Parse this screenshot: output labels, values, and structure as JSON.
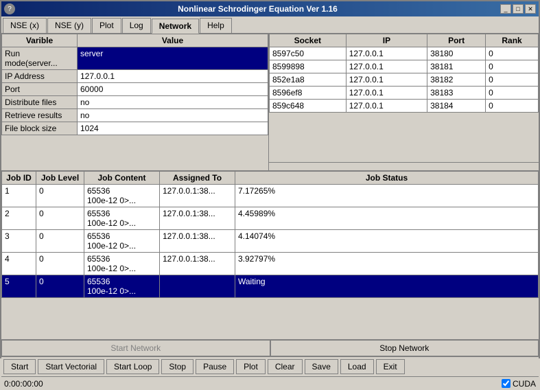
{
  "window": {
    "title": "Nonlinear Schrodinger Equation Ver 1.16",
    "icon": "?"
  },
  "titlebar": {
    "minimize_label": "_",
    "maximize_label": "□",
    "close_label": "✕"
  },
  "menu": {
    "tabs": [
      {
        "id": "nse-x",
        "label": "NSE (x)"
      },
      {
        "id": "nse-y",
        "label": "NSE (y)"
      },
      {
        "id": "plot",
        "label": "Plot"
      },
      {
        "id": "log",
        "label": "Log"
      },
      {
        "id": "network",
        "label": "Network",
        "active": true
      },
      {
        "id": "help",
        "label": "Help"
      }
    ]
  },
  "variables": {
    "header": {
      "varible": "Varible",
      "value": "Value"
    },
    "rows": [
      {
        "varible": "Run mode(server...",
        "value": "server",
        "selected": true
      },
      {
        "varible": "IP Address",
        "value": "127.0.0.1"
      },
      {
        "varible": "Port",
        "value": "60000"
      },
      {
        "varible": "Distribute files",
        "value": "no"
      },
      {
        "varible": "Retrieve results",
        "value": "no"
      },
      {
        "varible": "File block size",
        "value": "1024"
      }
    ]
  },
  "network": {
    "headers": [
      "Socket",
      "IP",
      "Port",
      "Rank"
    ],
    "rows": [
      {
        "socket": "8597c50",
        "ip": "127.0.0.1",
        "port": "38180",
        "rank": "0"
      },
      {
        "socket": "8599898",
        "ip": "127.0.0.1",
        "port": "38181",
        "rank": "0"
      },
      {
        "socket": "852e1a8",
        "ip": "127.0.0.1",
        "port": "38182",
        "rank": "0"
      },
      {
        "socket": "8596ef8",
        "ip": "127.0.0.1",
        "port": "38183",
        "rank": "0"
      },
      {
        "socket": "859c648",
        "ip": "127.0.0.1",
        "port": "38184",
        "rank": "0"
      }
    ]
  },
  "jobs": {
    "headers": [
      "Job ID",
      "Job Level",
      "Job Content",
      "Assigned To",
      "Job Status"
    ],
    "rows": [
      {
        "id": "1",
        "level": "0",
        "content": "65536\n100e-12 0>...",
        "assigned": "127.0.0.1:38...",
        "status": "7.17265%",
        "waiting": false
      },
      {
        "id": "2",
        "level": "0",
        "content": "65536\n100e-12 0>...",
        "assigned": "127.0.0.1:38...",
        "status": "4.45989%",
        "waiting": false
      },
      {
        "id": "3",
        "level": "0",
        "content": "65536\n100e-12 0>...",
        "assigned": "127.0.0.1:38...",
        "status": "4.14074%",
        "waiting": false
      },
      {
        "id": "4",
        "level": "0",
        "content": "65536\n100e-12 0>...",
        "assigned": "127.0.0.1:38...",
        "status": "3.92797%",
        "waiting": false
      },
      {
        "id": "5",
        "level": "0",
        "content": "65536\n100e-12 0>...",
        "assigned": "",
        "status": "Waiting",
        "waiting": true
      }
    ]
  },
  "actions": {
    "start_network": "Start Network",
    "stop_network": "Stop Network"
  },
  "toolbar": {
    "buttons": [
      "Start",
      "Start Vectorial",
      "Start Loop",
      "Stop",
      "Pause",
      "Plot",
      "Clear",
      "Save",
      "Load",
      "Exit"
    ]
  },
  "statusbar": {
    "time": "0:00:00:00",
    "cuda_label": "CUDA",
    "cuda_checked": true
  }
}
